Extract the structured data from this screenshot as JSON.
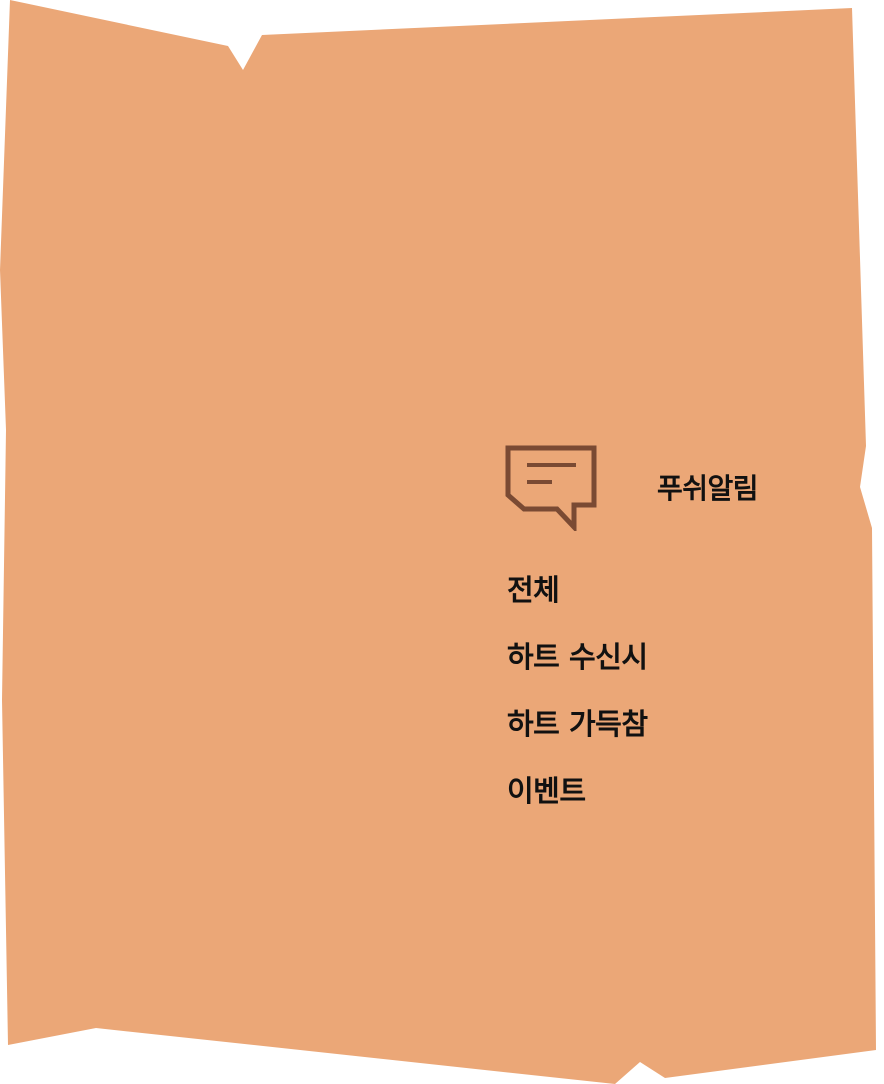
{
  "panel": {
    "background_color": "#EBA777",
    "icon_color": "#7A4A33",
    "text_color": "#111111"
  },
  "header": {
    "icon": "chat-bubble-icon",
    "title": "푸쉬알림"
  },
  "menu": {
    "items": [
      {
        "label": "전체"
      },
      {
        "label": "하트 수신시"
      },
      {
        "label": "하트 가득참"
      },
      {
        "label": "이벤트"
      }
    ]
  }
}
